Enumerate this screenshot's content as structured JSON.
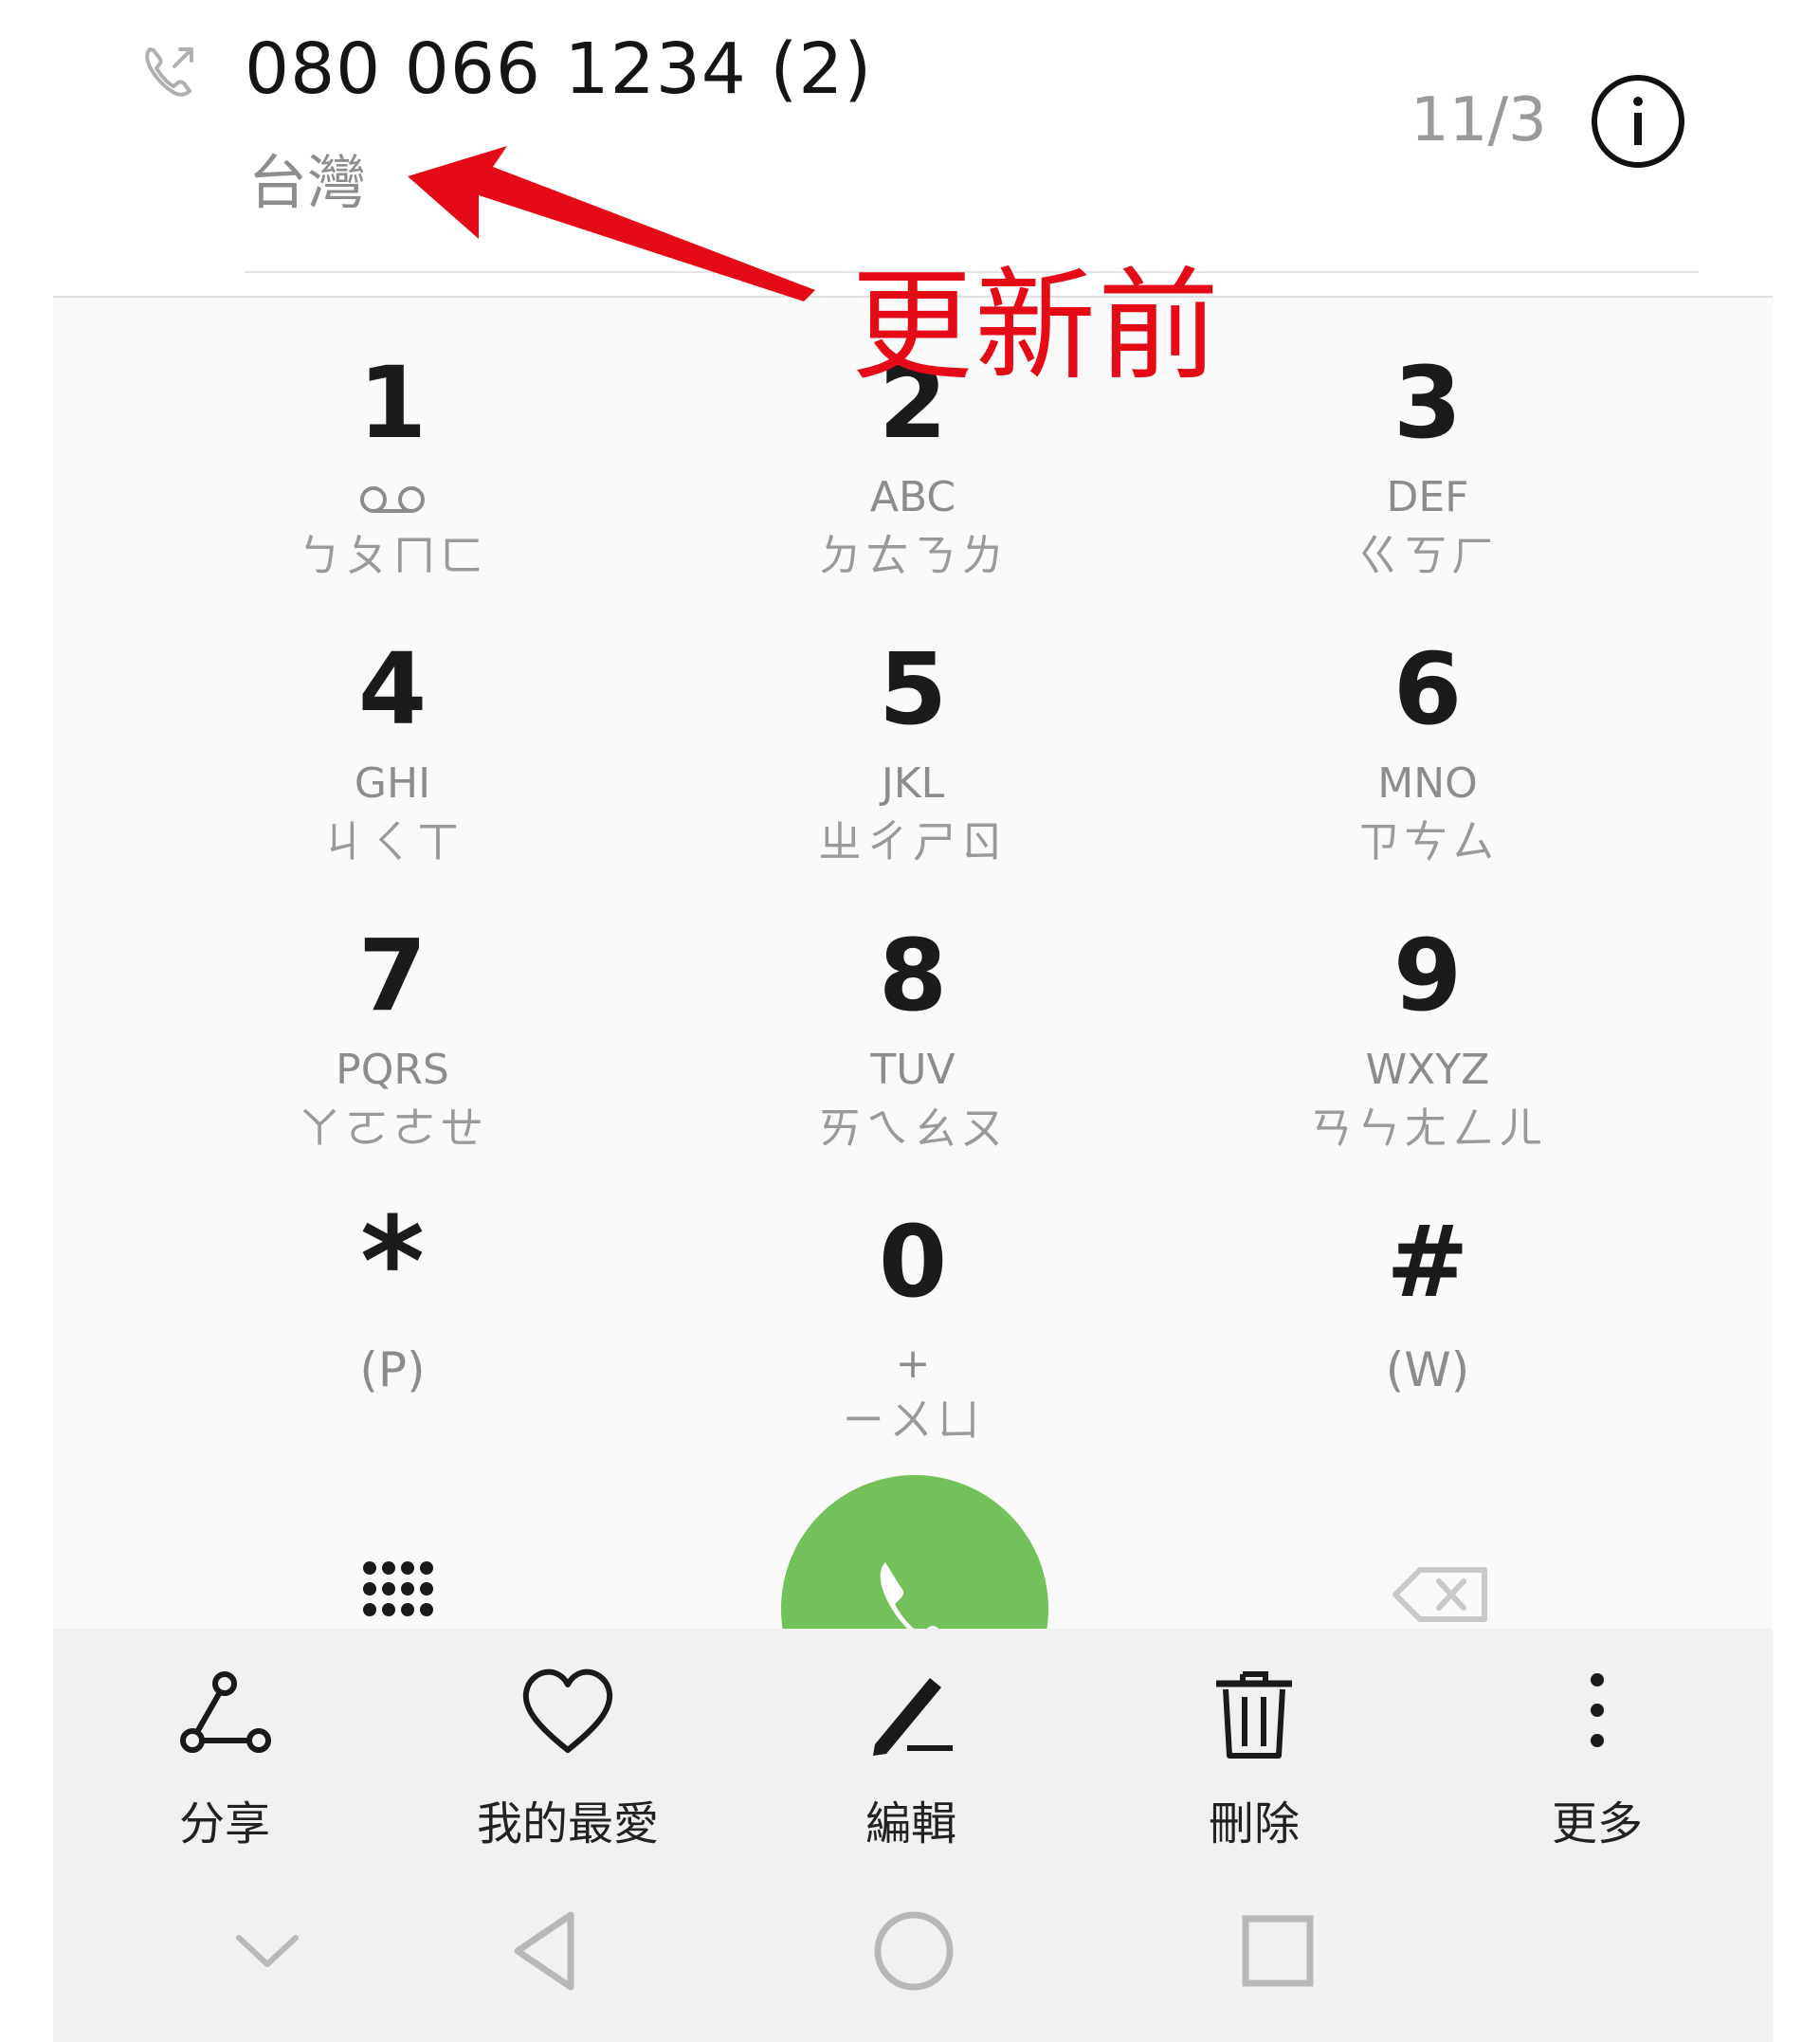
{
  "call_log": {
    "number": "080 066 1234",
    "count": "(2)",
    "location": "台灣",
    "date": "11/3",
    "call_type_icon": "outgoing-call-icon",
    "info_icon": "info-icon"
  },
  "annotation": {
    "text": "更新前",
    "color": "#e40b17"
  },
  "dialpad": {
    "keys": [
      {
        "digit": "1",
        "letters": "",
        "bopomofo": "ㄅㄆㄇㄈ",
        "icon": "voicemail-icon"
      },
      {
        "digit": "2",
        "letters": "ABC",
        "bopomofo": "ㄉㄊㄋㄌ"
      },
      {
        "digit": "3",
        "letters": "DEF",
        "bopomofo": "ㄍㄎㄏ"
      },
      {
        "digit": "4",
        "letters": "GHI",
        "bopomofo": "ㄐㄑㄒ"
      },
      {
        "digit": "5",
        "letters": "JKL",
        "bopomofo": "ㄓㄔㄕㄖ"
      },
      {
        "digit": "6",
        "letters": "MNO",
        "bopomofo": "ㄗㄘㄙ"
      },
      {
        "digit": "7",
        "letters": "PQRS",
        "bopomofo": "ㄚㄛㄜㄝ"
      },
      {
        "digit": "8",
        "letters": "TUV",
        "bopomofo": "ㄞㄟㄠㄡ"
      },
      {
        "digit": "9",
        "letters": "WXYZ",
        "bopomofo": "ㄢㄣㄤㄥㄦ"
      },
      {
        "digit": "*",
        "letters": "(P)",
        "bopomofo": ""
      },
      {
        "digit": "0",
        "letters": "+",
        "bopomofo": "ㄧㄨㄩ"
      },
      {
        "digit": "#",
        "letters": "(W)",
        "bopomofo": ""
      }
    ],
    "call_button_color": "#72c15a"
  },
  "actions": [
    {
      "label": "分享",
      "icon": "share-icon"
    },
    {
      "label": "我的最愛",
      "icon": "heart-icon"
    },
    {
      "label": "編輯",
      "icon": "edit-icon"
    },
    {
      "label": "刪除",
      "icon": "trash-icon"
    },
    {
      "label": "更多",
      "icon": "more-vertical-icon"
    }
  ],
  "navbar": [
    "hide-keyboard-icon",
    "back-icon",
    "home-icon",
    "recents-icon"
  ]
}
